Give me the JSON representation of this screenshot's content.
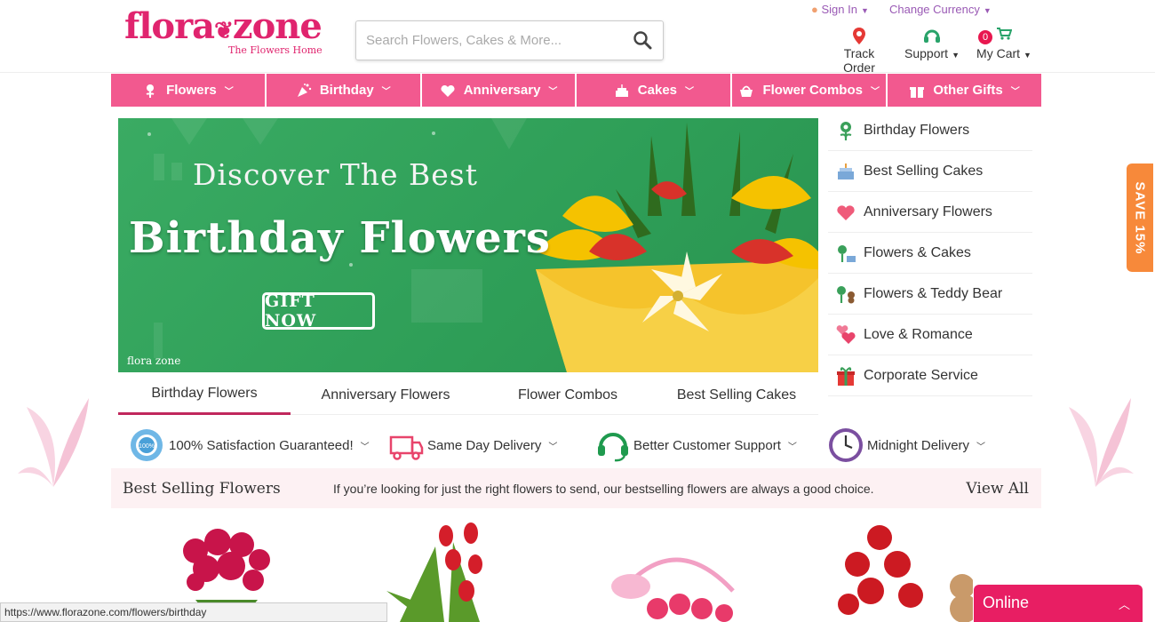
{
  "header": {
    "logo_text": "flora zone",
    "logo_tagline": "The Flowers Home",
    "search_placeholder": "Search Flowers, Cakes & More...",
    "sign_in": "Sign In",
    "change_currency": "Change Currency",
    "track_order": "Track Order",
    "support": "Support",
    "my_cart": "My Cart",
    "cart_count": "0"
  },
  "nav": {
    "items": [
      {
        "label": "Flowers"
      },
      {
        "label": "Birthday"
      },
      {
        "label": "Anniversary"
      },
      {
        "label": "Cakes"
      },
      {
        "label": "Flower Combos"
      },
      {
        "label": "Other Gifts"
      }
    ]
  },
  "banner": {
    "line1": "Discover The Best",
    "line2": "Birthday Flowers",
    "button": "GIFT NOW",
    "logo": "flora zone"
  },
  "side_categories": [
    {
      "label": "Birthday Flowers",
      "icon": "flower-icon"
    },
    {
      "label": "Best Selling Cakes",
      "icon": "cake-icon"
    },
    {
      "label": "Anniversary Flowers",
      "icon": "heart-icon"
    },
    {
      "label": "Flowers & Cakes",
      "icon": "flower-cake-icon"
    },
    {
      "label": "Flowers & Teddy Bear",
      "icon": "teddy-icon"
    },
    {
      "label": "Love & Romance",
      "icon": "hearts-icon"
    },
    {
      "label": "Corporate Service",
      "icon": "gift-icon"
    }
  ],
  "tabs": [
    {
      "label": "Birthday Flowers"
    },
    {
      "label": "Anniversary Flowers"
    },
    {
      "label": "Flower Combos"
    },
    {
      "label": "Best Selling Cakes"
    }
  ],
  "features": [
    {
      "label": "100% Satisfaction Guaranteed!",
      "icon": "badge-icon"
    },
    {
      "label": "Same Day Delivery",
      "icon": "truck-icon"
    },
    {
      "label": "Better Customer Support",
      "icon": "headset-icon"
    },
    {
      "label": "Midnight Delivery",
      "icon": "clock-icon"
    }
  ],
  "best_selling": {
    "title": "Best Selling Flowers",
    "description": "If you’re looking for just the right flowers to send, our bestselling flowers are always a good choice.",
    "view_all": "View All"
  },
  "save_tab": "SAVE 15%",
  "status_url": "https://www.florazone.com/flowers/birthday",
  "chat": {
    "label": "Online"
  },
  "colors": {
    "brand_pink": "#f2598f",
    "logo_pink": "#e0246e",
    "banner_green": "#3aab63",
    "save_orange": "#f7893a"
  }
}
